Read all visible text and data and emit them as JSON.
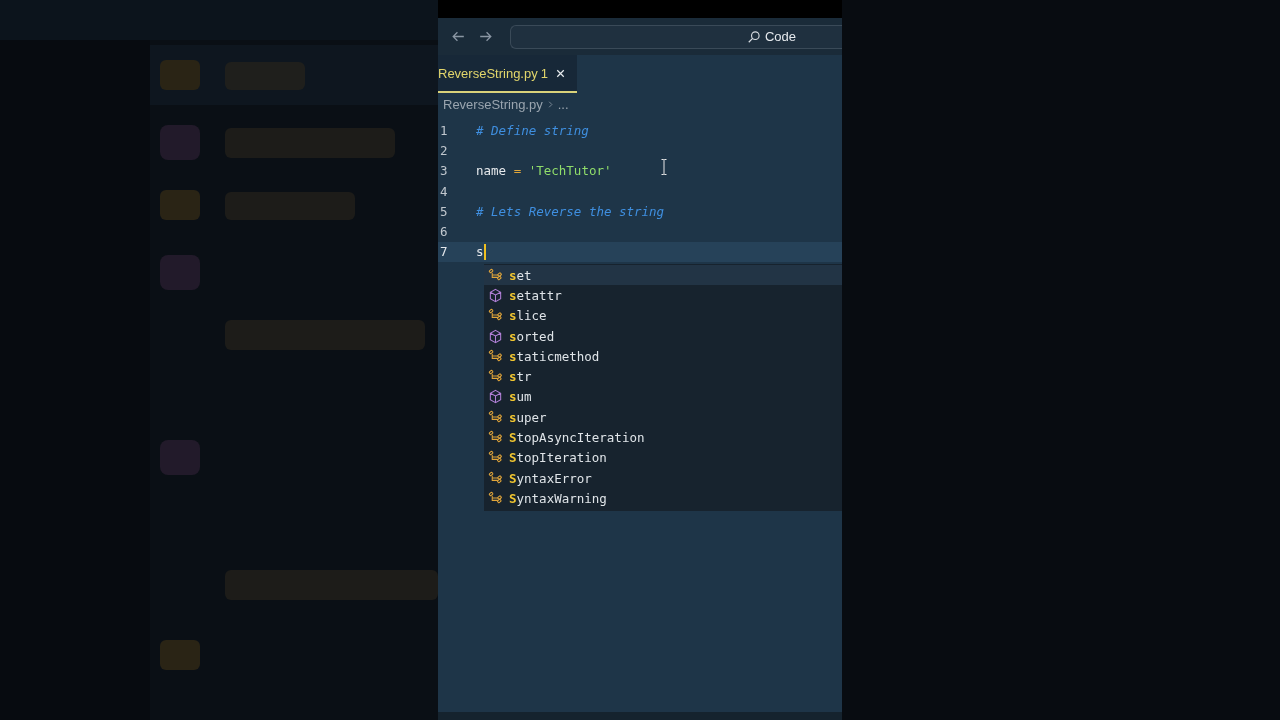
{
  "title_bar": {
    "search_label": "Code"
  },
  "tabs": [
    {
      "label": "ReverseString.py",
      "problems": "1",
      "selected": true
    }
  ],
  "breadcrumb": {
    "file": "ReverseString.py",
    "more": "..."
  },
  "code_lines": [
    {
      "number": "1",
      "current": false,
      "tokens": [
        {
          "kind": "comment",
          "text": "# Define string"
        }
      ]
    },
    {
      "number": "2",
      "current": false
    },
    {
      "number": "3",
      "current": false,
      "tokens": [
        {
          "kind": "plain",
          "text": "name "
        },
        {
          "kind": "operator",
          "text": "= "
        },
        {
          "kind": "string",
          "text": "'TechTutor'"
        }
      ]
    },
    {
      "number": "4",
      "current": false
    },
    {
      "number": "5",
      "current": false,
      "tokens": [
        {
          "kind": "comment",
          "text": "# Lets Reverse the string"
        }
      ]
    },
    {
      "number": "6",
      "current": false
    },
    {
      "number": "7",
      "current": true,
      "tokens": [
        {
          "kind": "plain",
          "text": "s"
        }
      ]
    }
  ],
  "suggestions": [
    {
      "kind": "class",
      "match": "s",
      "rest": "et",
      "selected": true
    },
    {
      "kind": "function",
      "match": "s",
      "rest": "etattr",
      "selected": false
    },
    {
      "kind": "class",
      "match": "s",
      "rest": "lice",
      "selected": false
    },
    {
      "kind": "function",
      "match": "s",
      "rest": "orted",
      "selected": false
    },
    {
      "kind": "class",
      "match": "s",
      "rest": "taticmethod",
      "selected": false
    },
    {
      "kind": "class",
      "match": "s",
      "rest": "tr",
      "selected": false
    },
    {
      "kind": "function",
      "match": "s",
      "rest": "um",
      "selected": false
    },
    {
      "kind": "class",
      "match": "s",
      "rest": "uper",
      "selected": false
    },
    {
      "kind": "class",
      "match": "S",
      "rest": "topAsyncIteration",
      "selected": false
    },
    {
      "kind": "class",
      "match": "S",
      "rest": "topIteration",
      "selected": false
    },
    {
      "kind": "class",
      "match": "S",
      "rest": "yntaxError",
      "selected": false
    },
    {
      "kind": "class",
      "match": "S",
      "rest": "yntaxWarning",
      "selected": false
    }
  ]
}
